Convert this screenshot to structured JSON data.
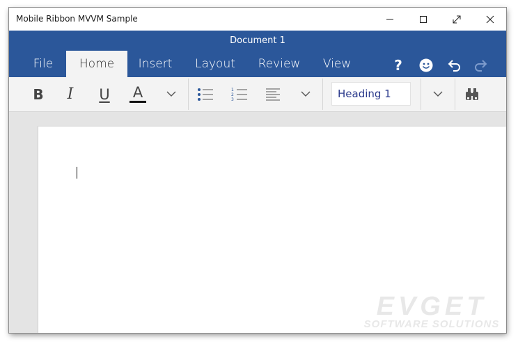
{
  "window": {
    "title": "Mobile Ribbon MVVM Sample",
    "controls": [
      "minimize-icon",
      "maximize-icon",
      "fullscreen-icon",
      "close-icon"
    ]
  },
  "ribbon": {
    "document_title": "Document 1",
    "accent_color": "#2b579a",
    "tabs": [
      {
        "label": "File"
      },
      {
        "label": "Home",
        "active": true
      },
      {
        "label": "Insert"
      },
      {
        "label": "Layout"
      },
      {
        "label": "Review"
      },
      {
        "label": "View"
      }
    ],
    "header_icons": {
      "help": "?",
      "smile": "smiley-icon",
      "undo": "undo-icon",
      "redo": "redo-icon"
    }
  },
  "toolbar": {
    "bold_label": "B",
    "italic_label": "I",
    "underline_label": "U",
    "font_color_label": "A",
    "font_color": "#111111",
    "style_value": "Heading 1",
    "icons": [
      "bullet-list-icon",
      "numbered-list-icon",
      "align-left-icon",
      "chevron-down-icon",
      "binoculars-icon"
    ]
  },
  "watermark": {
    "main": "EVGET",
    "sub": "SOFTWARE SOLUTIONS"
  }
}
